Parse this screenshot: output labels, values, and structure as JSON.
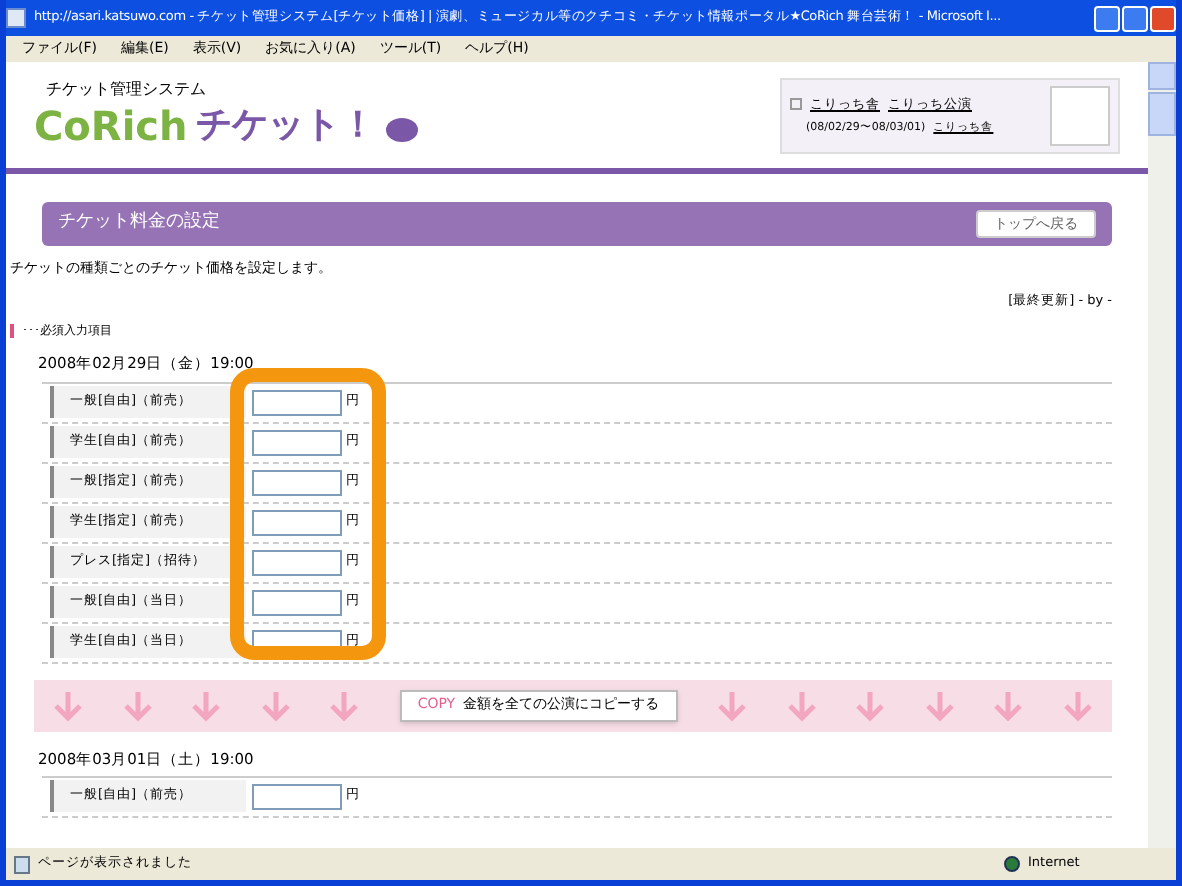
{
  "window": {
    "title": "http://asari.katsuwo.com - チケット管理システム[チケット価格] | 演劇、ミュージカル等のクチコミ・チケット情報ポータル★CoRich 舞台芸術！ - Microsoft I..."
  },
  "menu": [
    "ファイル(F)",
    "編集(E)",
    "表示(V)",
    "お気に入り(A)",
    "ツール(T)",
    "ヘルプ(H)"
  ],
  "header": {
    "system_name": "チケット管理システム",
    "logo_latin": "CoRich",
    "logo_kana": "チケット！",
    "account": {
      "name_link": "こりっち舎",
      "performance_link": "こりっち公演",
      "period": "(08/02/29〜08/03/01)",
      "owner_link": "こりっち舎"
    }
  },
  "section": {
    "title": "チケット料金の設定",
    "back_button": "トップへ戻る",
    "description": "チケットの種類ごとのチケット価格を設定します。",
    "updated": "[最終更新] - by -",
    "legend": "･･･必須入力項目"
  },
  "performances": [
    {
      "date": "2008年02月29日（金）19:00",
      "rows": [
        {
          "label": "一般[自由]（前売）",
          "unit": "円"
        },
        {
          "label": "学生[自由]（前売）",
          "unit": "円"
        },
        {
          "label": "一般[指定]（前売）",
          "unit": "円"
        },
        {
          "label": "学生[指定]（前売）",
          "unit": "円"
        },
        {
          "label": "プレス[指定]（招待）",
          "unit": "円"
        },
        {
          "label": "一般[自由]（当日）",
          "unit": "円"
        },
        {
          "label": "学生[自由]（当日）",
          "unit": "円"
        }
      ],
      "highlighted": true
    },
    {
      "date": "2008年03月01日（土）19:00",
      "rows": [
        {
          "label": "一般[自由]（前売）",
          "unit": "円"
        }
      ],
      "highlighted": false
    }
  ],
  "copy_button": {
    "tag": "COPY",
    "label": "金額を全ての公演にコピーする"
  },
  "status_bar": {
    "message": "ページが表示されました",
    "zone": "Internet"
  }
}
